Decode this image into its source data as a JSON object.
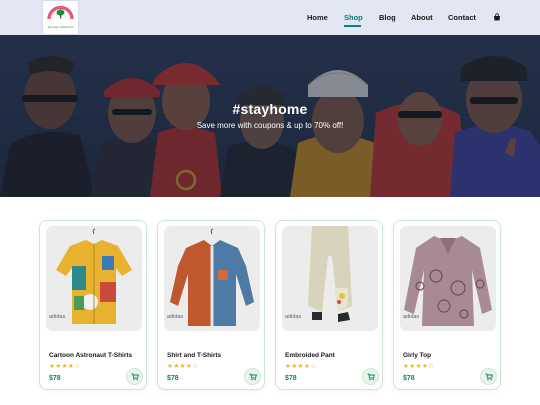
{
  "header": {
    "logo": {
      "ring_text": "D.Q. FASHION STORE",
      "tagline": "Quality Attitudes"
    },
    "nav": [
      {
        "label": "Home",
        "active": false
      },
      {
        "label": "Shop",
        "active": true
      },
      {
        "label": "Blog",
        "active": false
      },
      {
        "label": "About",
        "active": false
      },
      {
        "label": "Contact",
        "active": false
      }
    ],
    "cart_icon": "shopping-bag-icon",
    "accent_color": "#088178"
  },
  "hero": {
    "title": "#stayhome",
    "subtitle": "Save more with coupons & up to 70% off!"
  },
  "products": [
    {
      "brand": "adidas",
      "name": "Cartoon Astronaut T-Shirts",
      "rating": 4,
      "max_rating": 5,
      "stars_text": "★★★★☆",
      "price": "$78",
      "cart_icon": "cart-icon"
    },
    {
      "brand": "adidas",
      "name": "Shirt and T-Shirts",
      "rating": 4,
      "max_rating": 5,
      "stars_text": "★★★★☆",
      "price": "$78",
      "cart_icon": "cart-icon"
    },
    {
      "brand": "adidas",
      "name": "Embroided Pant",
      "rating": 4,
      "max_rating": 5,
      "stars_text": "★★★★☆",
      "price": "$78",
      "cart_icon": "cart-icon"
    },
    {
      "brand": "adidas",
      "name": "Girly Top",
      "rating": 4,
      "max_rating": 5,
      "stars_text": "★★★★☆",
      "price": "$78",
      "cart_icon": "cart-icon"
    }
  ]
}
